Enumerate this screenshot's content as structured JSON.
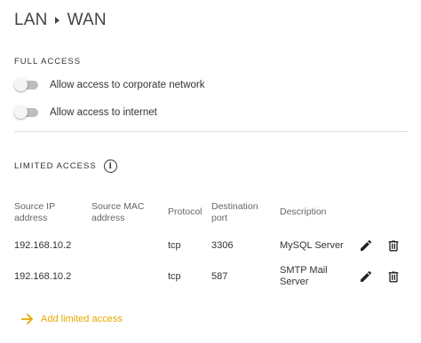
{
  "breadcrumb": {
    "from": "LAN",
    "to": "WAN"
  },
  "full_access": {
    "heading": "FULL ACCESS",
    "toggles": [
      {
        "label": "Allow access to corporate network",
        "enabled": false
      },
      {
        "label": "Allow access to internet",
        "enabled": false
      }
    ]
  },
  "limited_access": {
    "heading": "LIMITED ACCESS",
    "info_icon": "info-icon",
    "columns": {
      "source_ip": [
        "Source IP",
        "address"
      ],
      "source_mac": [
        "Source MAC",
        "address"
      ],
      "protocol": [
        "Protocol"
      ],
      "destination_port": [
        "Destination",
        "port"
      ],
      "description": [
        "Description"
      ]
    },
    "rows": [
      {
        "source_ip": "192.168.10.2",
        "source_mac": "",
        "protocol": "tcp",
        "destination_port": "3306",
        "description": [
          "MySQL Server"
        ]
      },
      {
        "source_ip": "192.168.10.2",
        "source_mac": "",
        "protocol": "tcp",
        "destination_port": "587",
        "description": [
          "SMTP Mail",
          "Server"
        ]
      }
    ],
    "add_label": "Add limited access"
  },
  "colors": {
    "accent": "#e6a800",
    "toggle_off_track": "#bdbdbd",
    "divider": "#e0e0e0"
  }
}
